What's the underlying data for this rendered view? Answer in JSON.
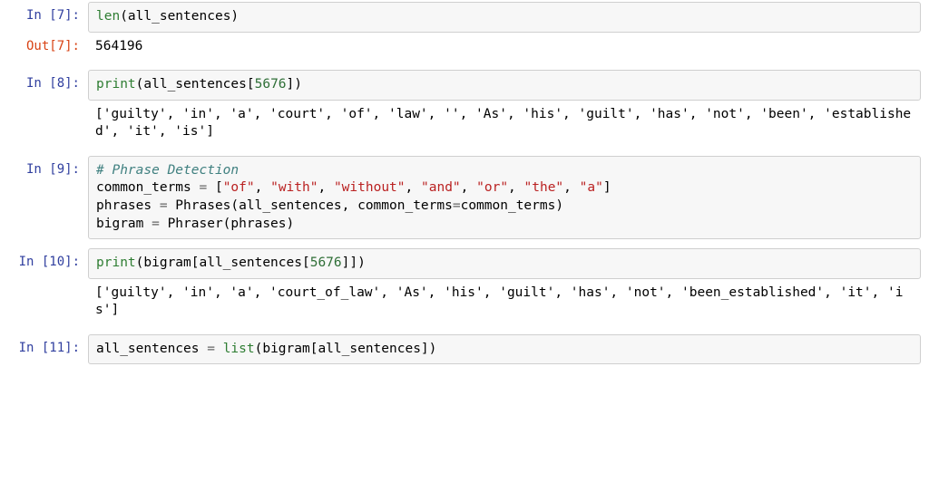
{
  "cells": {
    "c7": {
      "prompt_in": "In [7]:",
      "prompt_out": "Out[7]:",
      "code_html": "<span class='fn'>len</span>(all_sentences)",
      "out_text": "564196"
    },
    "c8": {
      "prompt_in": "In [8]:",
      "code_html": "<span class='fn'>print</span>(all_sentences[<span class='num'>5676</span>])",
      "out_text": "['guilty', 'in', 'a', 'court', 'of', 'law', '', 'As', 'his', 'guilt', 'has', 'not', 'been', 'established', 'it', 'is']"
    },
    "c9": {
      "prompt_in": "In [9]:",
      "code_html": "<span class='com'># Phrase Detection</span>\ncommon_terms <span class='op'>=</span> [<span class='str'>\"of\"</span>, <span class='str'>\"with\"</span>, <span class='str'>\"without\"</span>, <span class='str'>\"and\"</span>, <span class='str'>\"or\"</span>, <span class='str'>\"the\"</span>, <span class='str'>\"a\"</span>]\nphrases <span class='op'>=</span> Phrases(all_sentences, common_terms<span class='op'>=</span>common_terms)\nbigram <span class='op'>=</span> Phraser(phrases)"
    },
    "c10": {
      "prompt_in": "In [10]:",
      "code_html": "<span class='fn'>print</span>(bigram[all_sentences[<span class='num'>5676</span>]])",
      "out_text": "['guilty', 'in', 'a', 'court_of_law', 'As', 'his', 'guilt', 'has', 'not', 'been_established', 'it', 'is']"
    },
    "c11": {
      "prompt_in": "In [11]:",
      "code_html": "all_sentences <span class='op'>=</span> <span class='fn'>list</span>(bigram[all_sentences])"
    }
  }
}
